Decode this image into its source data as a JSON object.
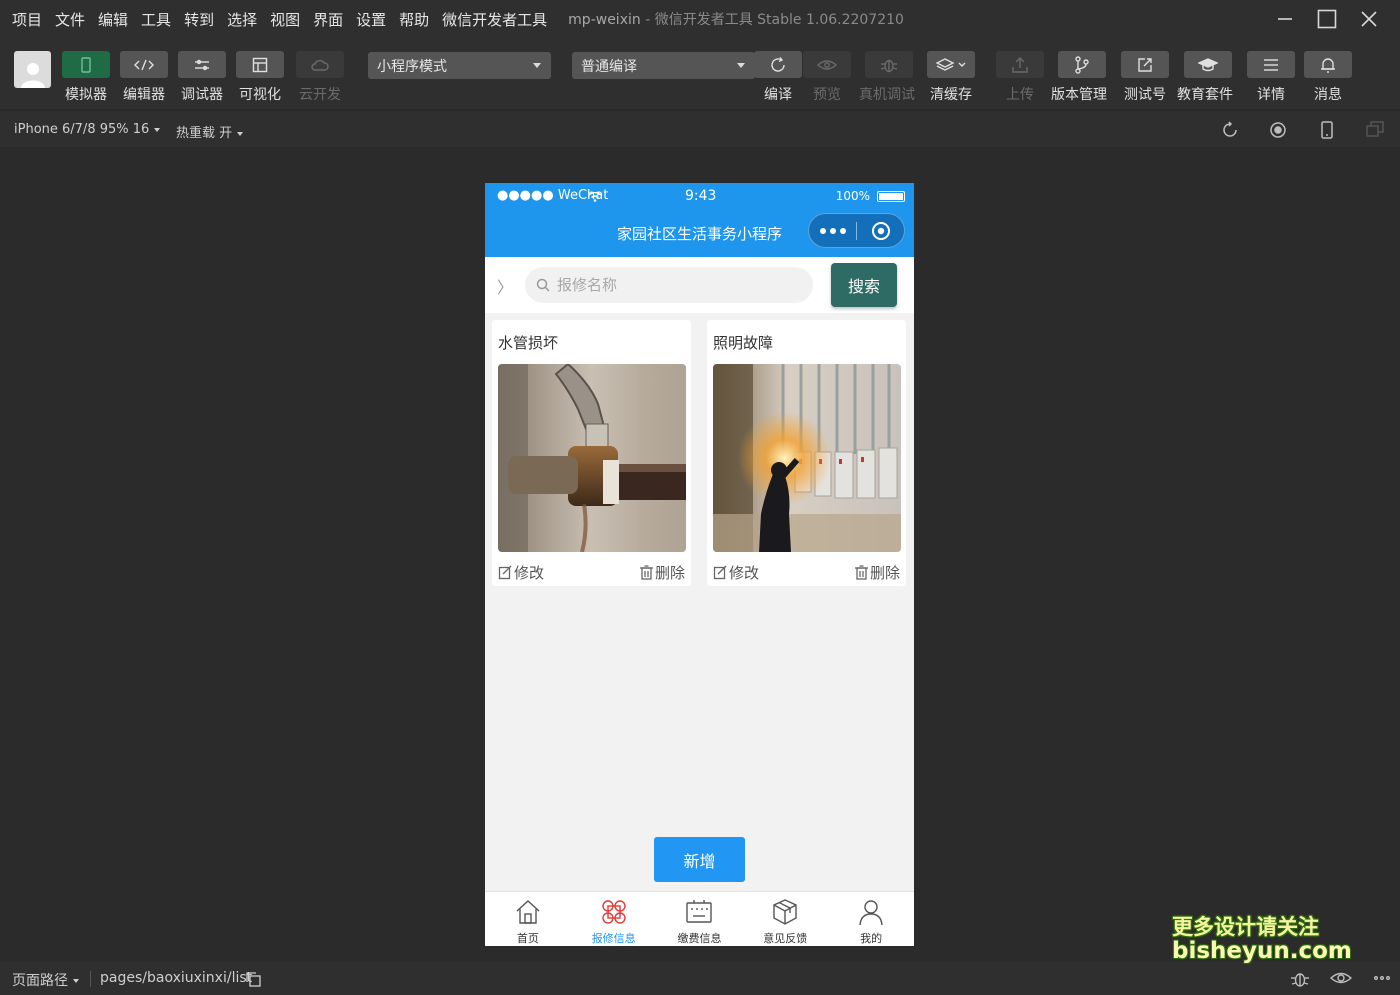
{
  "menubar": {
    "items": [
      "项目",
      "文件",
      "编辑",
      "工具",
      "转到",
      "选择",
      "视图",
      "界面",
      "设置",
      "帮助",
      "微信开发者工具"
    ],
    "project": "mp-weixin",
    "separator": "-",
    "app_title": "微信开发者工具 Stable 1.06.2207210"
  },
  "toolbar": {
    "simulator": "模拟器",
    "editor": "编辑器",
    "debugger": "调试器",
    "visual": "可视化",
    "cloud": "云开发",
    "mode_select": "小程序模式",
    "compile_select": "普通编译",
    "compile": "编译",
    "preview": "预览",
    "remote_debug": "真机调试",
    "clear_cache": "清缓存",
    "upload": "上传",
    "version": "版本管理",
    "test_account": "测试号",
    "education": "教育套件",
    "details": "详情",
    "messages": "消息"
  },
  "subbar": {
    "device": "iPhone 6/7/8 95% 16",
    "hot_reload": "热重载 开"
  },
  "phone": {
    "status": {
      "carrier": "●●●●● WeChat",
      "time": "9:43",
      "battery": "100%"
    },
    "nav_title": "家园社区生活事务小程序",
    "search": {
      "placeholder": "报修名称",
      "button": "搜索",
      "chevron": "〉"
    },
    "cards": [
      {
        "title": "水管损坏",
        "edit": "修改",
        "delete": "删除"
      },
      {
        "title": "照明故障",
        "edit": "修改",
        "delete": "删除"
      }
    ],
    "add_button": "新增",
    "tabs": [
      {
        "label": "首页",
        "icon": "home-icon",
        "active": false
      },
      {
        "label": "报修信息",
        "icon": "grid-icon",
        "active": true
      },
      {
        "label": "缴费信息",
        "icon": "keyboard-icon",
        "active": false
      },
      {
        "label": "意见反馈",
        "icon": "box-icon",
        "active": false
      },
      {
        "label": "我的",
        "icon": "user-icon",
        "active": false
      }
    ],
    "colors": {
      "primary": "#1e96ee",
      "search_button": "#2d6b64",
      "active_tab_icon": "#e53935"
    }
  },
  "bottombar": {
    "path_label": "页面路径",
    "path_value": "pages/baoxiuxinxi/list"
  },
  "watermark": {
    "line1": "更多设计请关注",
    "line2": "bisheyun.com"
  }
}
